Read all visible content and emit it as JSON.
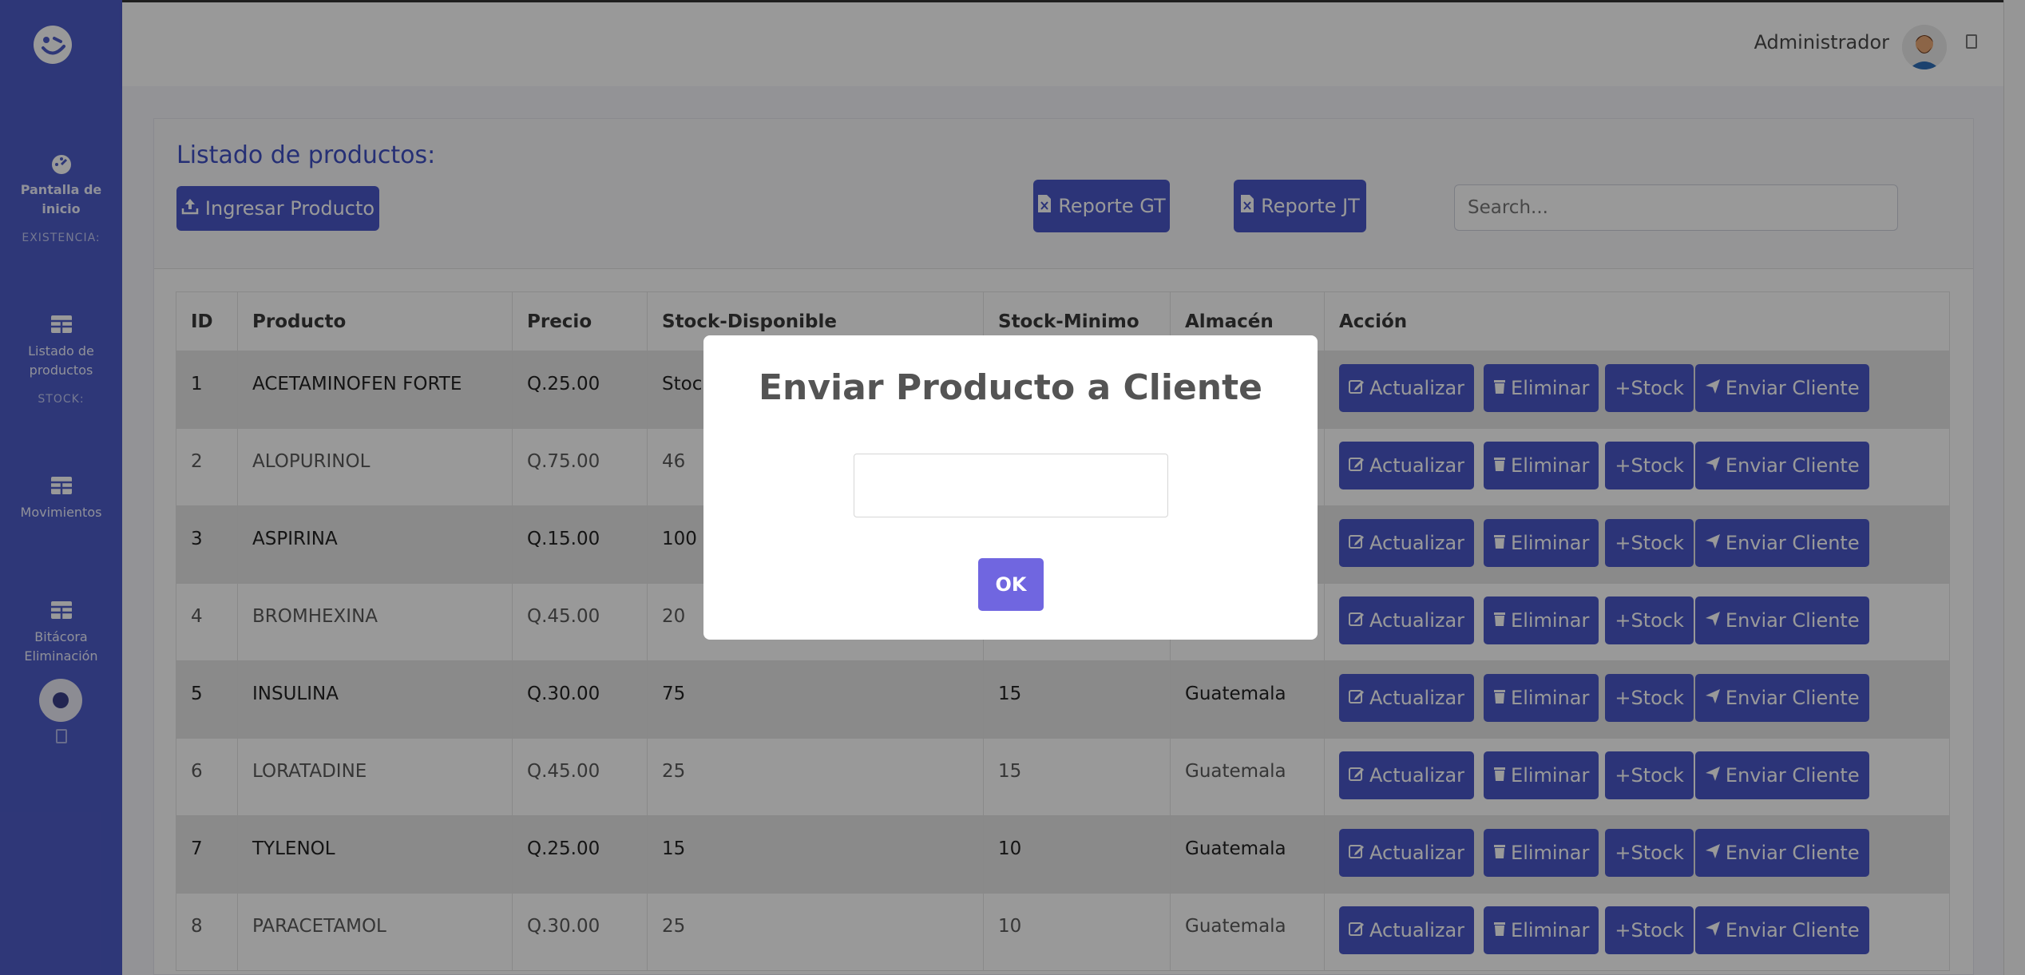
{
  "sidebar": {
    "items": [
      {
        "label_line1": "Pantalla de",
        "label_line2": "inicio"
      },
      {
        "label_line1": "Listado de",
        "label_line2": "productos"
      },
      {
        "label_line1": "Movimientos",
        "label_line2": ""
      },
      {
        "label_line1": "Bitácora",
        "label_line2": "Eliminación"
      }
    ],
    "headings": [
      "EXISTENCIA:",
      "STOCK:"
    ]
  },
  "topbar": {
    "user_name": "Administrador"
  },
  "card": {
    "title": "Listado de productos:",
    "ingresar_label": "Ingresar Producto",
    "reporte_gt_label": "Reporte GT",
    "reporte_jt_label": "Reporte JT",
    "search_placeholder": "Search..."
  },
  "table": {
    "headers": [
      "ID",
      "Producto",
      "Precio",
      "Stock-Disponible",
      "Stock-Minimo",
      "Almacén",
      "Acción"
    ],
    "rows": [
      {
        "id": "1",
        "producto": "ACETAMINOFEN FORTE",
        "precio": "Q.25.00",
        "stock": "Stock",
        "minimo": "",
        "almacen": ""
      },
      {
        "id": "2",
        "producto": "ALOPURINOL",
        "precio": "Q.75.00",
        "stock": "46",
        "minimo": "",
        "almacen": ""
      },
      {
        "id": "3",
        "producto": "ASPIRINA",
        "precio": "Q.15.00",
        "stock": "100",
        "minimo": "",
        "almacen": ""
      },
      {
        "id": "4",
        "producto": "BROMHEXINA",
        "precio": "Q.45.00",
        "stock": "20",
        "minimo": "",
        "almacen": ""
      },
      {
        "id": "5",
        "producto": "INSULINA",
        "precio": "Q.30.00",
        "stock": "75",
        "minimo": "15",
        "almacen": "Guatemala"
      },
      {
        "id": "6",
        "producto": "LORATADINE",
        "precio": "Q.45.00",
        "stock": "25",
        "minimo": "15",
        "almacen": "Guatemala"
      },
      {
        "id": "7",
        "producto": "TYLENOL",
        "precio": "Q.25.00",
        "stock": "15",
        "minimo": "10",
        "almacen": "Guatemala"
      },
      {
        "id": "8",
        "producto": "PARACETAMOL",
        "precio": "Q.30.00",
        "stock": "25",
        "minimo": "10",
        "almacen": "Guatemala"
      }
    ],
    "actions": {
      "actualizar": "Actualizar",
      "eliminar": "Eliminar",
      "stock": "+Stock",
      "enviar": "Enviar Cliente"
    }
  },
  "modal": {
    "title": "Enviar Producto a Cliente",
    "input_value": "",
    "ok_label": "OK"
  },
  "colors": {
    "sidebar": "#4e5cc8",
    "primary_button": "#4a58c9",
    "modal_ok": "#7066e0",
    "title_blue": "#3f4fc4",
    "stock_warning": "#d23030"
  },
  "icons": [
    "logo-icon",
    "dashboard-icon",
    "table-icon",
    "upload-icon",
    "file-excel-icon",
    "edit-icon",
    "trash-icon",
    "plus-icon",
    "send-icon"
  ]
}
